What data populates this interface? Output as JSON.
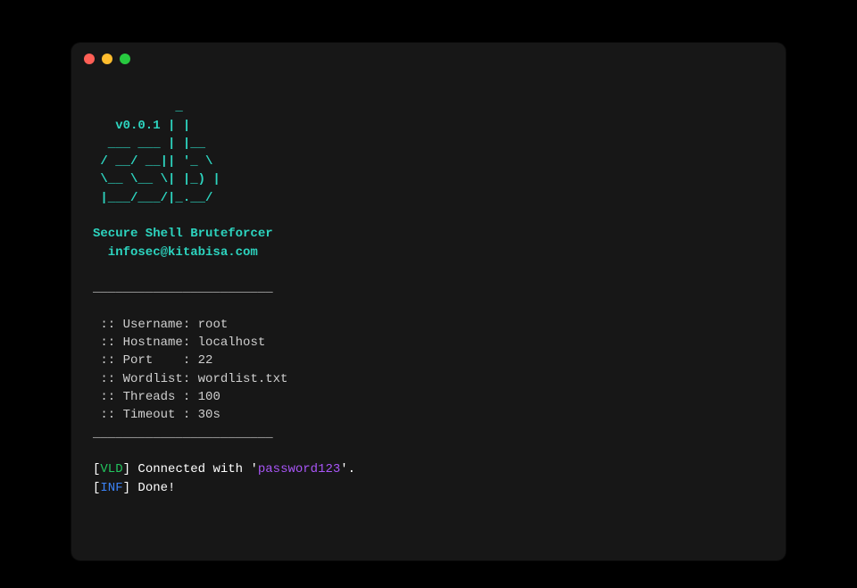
{
  "banner": {
    "ascii": "           _\n   v0.0.1 | |\n  ___ ___ | |__\n / __/ __|| '_ \\\n \\__ \\__ \\| |_) |\n |___/___/|_.__/",
    "title": "Secure Shell Bruteforcer",
    "subtitle": "  infosec@kitabisa.com"
  },
  "divider": "________________________",
  "config_prefix": " :: ",
  "config": [
    {
      "label": "Username:",
      "value": "root"
    },
    {
      "label": "Hostname:",
      "value": "localhost"
    },
    {
      "label": "Port    :",
      "value": "22"
    },
    {
      "label": "Wordlist:",
      "value": "wordlist.txt"
    },
    {
      "label": "Threads :",
      "value": "100"
    },
    {
      "label": "Timeout :",
      "value": "30s"
    }
  ],
  "log": {
    "vld": {
      "tag": "VLD",
      "before": " Connected with '",
      "password": "password123",
      "after": "'."
    },
    "inf": {
      "tag": "INF",
      "text": " Done!"
    }
  },
  "brackets": {
    "open": "[",
    "close": "]"
  }
}
